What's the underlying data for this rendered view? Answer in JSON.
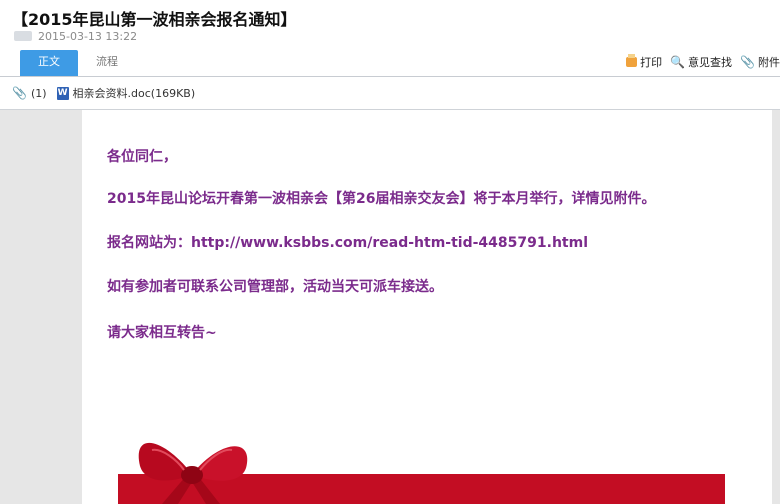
{
  "email": {
    "title": "【2015年昆山第一波相亲会报名通知】",
    "date": "2015-03-13 13:22"
  },
  "tabs": [
    {
      "label": "正文",
      "active": true
    },
    {
      "label": "流程",
      "active": false
    }
  ],
  "toolbar": {
    "print_label": "打印",
    "feedback_label": "意见查找",
    "attachment_label": "附件"
  },
  "attachments": {
    "count": "(1)",
    "file_name": "相亲会资料.doc(169KB)",
    "file_icon": "W"
  },
  "body": {
    "line1": "各位同仁，",
    "line2": "2015年昆山论坛开春第一波相亲会【第26届相亲交友会】将于本月举行，详情见附件。",
    "line3": "报名网站为：http://www.ksbbs.com/read-htm-tid-4485791.html",
    "line4": "如有参加者可联系公司管理部，活动当天可派车接送。",
    "line5": "请大家相互转告~"
  },
  "colors": {
    "accent_tab": "#3e9be5",
    "body_text": "#7b2b8c",
    "ribbon": "#c30d23"
  }
}
